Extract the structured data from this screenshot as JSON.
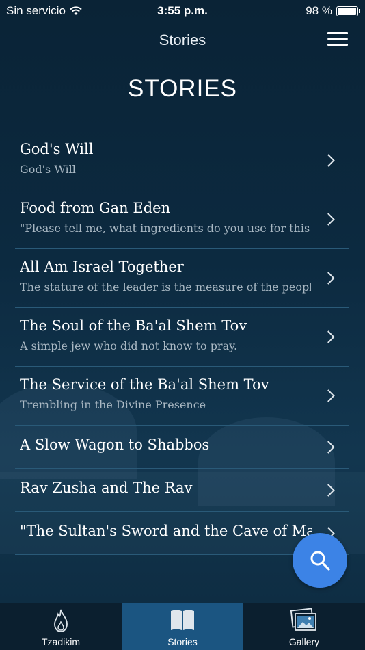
{
  "status_bar": {
    "carrier": "Sin servicio",
    "time": "3:55 p.m.",
    "battery_percent": "98 %",
    "battery_level": 0.98
  },
  "header": {
    "title": "Stories",
    "menu_icon": "hamburger-menu-icon"
  },
  "page": {
    "heading": "STORIES"
  },
  "stories": [
    {
      "title": "God's Will",
      "subtitle": "God's Will"
    },
    {
      "title": "Food from Gan Eden",
      "subtitle": "\"Please tell me, what ingredients do you use for this s"
    },
    {
      "title": "All Am Israel Together",
      "subtitle": "The stature of the leader is the measure of the people"
    },
    {
      "title": "The Soul of the Ba'al Shem Tov",
      "subtitle": "A simple jew who did not know to pray."
    },
    {
      "title": "The Service of the Ba'al Shem Tov",
      "subtitle": "Trembling in the Divine Presence"
    },
    {
      "title": "A Slow Wagon to Shabbos",
      "subtitle": ""
    },
    {
      "title": "Rav Zusha and The Rav",
      "subtitle": ""
    },
    {
      "title": " \"The Sultan's Sword and the Cave of Ma",
      "subtitle": ""
    }
  ],
  "search_button": {
    "icon": "search-icon",
    "color": "#3c83e6"
  },
  "tabs": [
    {
      "label": "Tzadikim",
      "icon": "flame-icon",
      "active": false
    },
    {
      "label": "Stories",
      "icon": "open-book-icon",
      "active": true
    },
    {
      "label": "Gallery",
      "icon": "gallery-icon",
      "active": false
    }
  ],
  "colors": {
    "background": "#0c2a40",
    "tab_active": "#1b5581",
    "accent": "#3c83e6"
  }
}
